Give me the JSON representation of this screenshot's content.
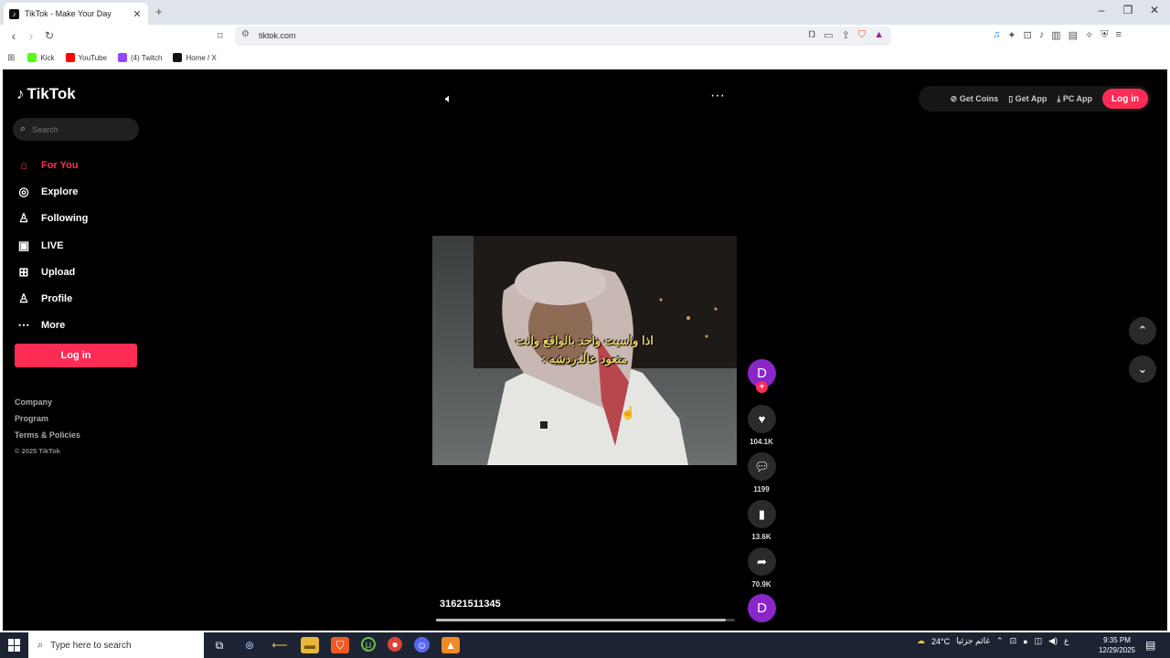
{
  "browser": {
    "tab_title": "TikTok - Make Your Day",
    "tab_close": "✕",
    "new_tab": "+",
    "url": "tiktok.com",
    "bookmarks": [
      {
        "label": "Kick",
        "color": "#53fc18"
      },
      {
        "label": "YouTube",
        "color": "#ff0000"
      },
      {
        "label": "(4) Twitch",
        "color": "#9146ff"
      },
      {
        "label": "Home / X",
        "color": "#111111"
      }
    ]
  },
  "sidebar": {
    "logo": "TikTok",
    "search_placeholder": "Search",
    "nav": [
      {
        "label": "For You",
        "icon": "home-icon",
        "glyph": "⌂",
        "active": true
      },
      {
        "label": "Explore",
        "icon": "compass-icon",
        "glyph": "◎",
        "active": false
      },
      {
        "label": "Following",
        "icon": "user-plus-icon",
        "glyph": "♙",
        "active": false
      },
      {
        "label": "LIVE",
        "icon": "live-tv-icon",
        "glyph": "▣",
        "active": false
      },
      {
        "label": "Upload",
        "icon": "upload-icon",
        "glyph": "⊞",
        "active": false
      },
      {
        "label": "Profile",
        "icon": "profile-icon",
        "glyph": "♙",
        "active": false
      },
      {
        "label": "More",
        "icon": "more-dots-icon",
        "glyph": "⋯",
        "active": false
      }
    ],
    "login_label": "Log in",
    "footer": {
      "company": "Company",
      "program": "Program",
      "terms": "Terms & Policies",
      "copyright": "© 2025 TikTok"
    }
  },
  "header": {
    "get_coins": "Get Coins",
    "get_app": "Get App",
    "pc_app": "PC App",
    "login_label": "Log in"
  },
  "video": {
    "caption_line1": "اذا واسيت واحد بالواقع وانت",
    "caption_line2": "متعود عالدردشه :",
    "author_id": "31621511345",
    "avatar_letter": "D",
    "progress": 0.97,
    "likes": "104.1K",
    "comments": "1199",
    "saves": "13.6K",
    "shares": "70.9K"
  },
  "taskbar": {
    "search_text": "Type here to search",
    "weather": "24°C",
    "weather_text": "غائم جزئيا",
    "lang": "ع",
    "time": "9:35 PM",
    "date": "12/29/2025"
  },
  "colors": {
    "accent": "#fe2c55",
    "avatar": "#8a26c9",
    "page_bg": "#000000"
  }
}
